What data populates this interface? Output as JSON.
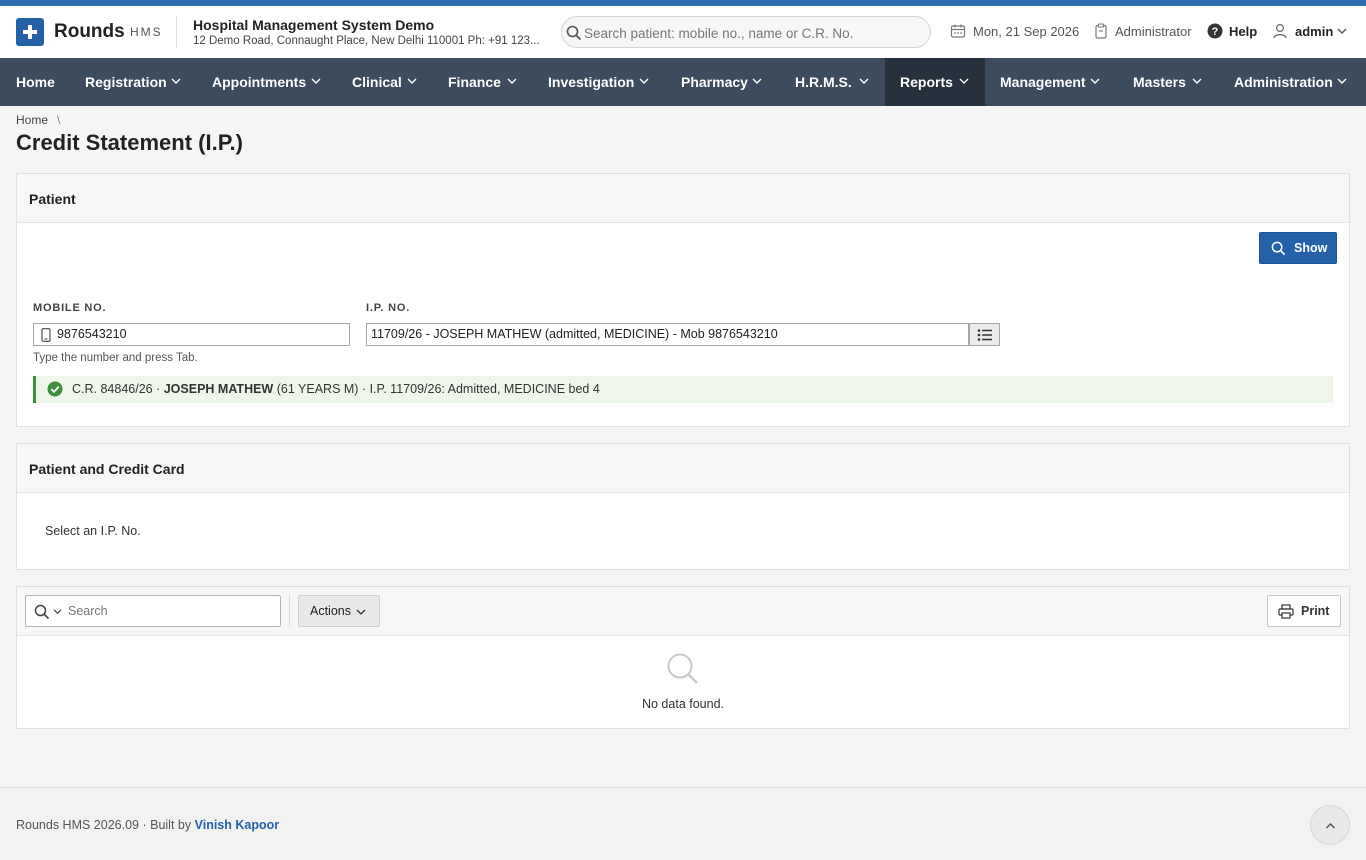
{
  "app": {
    "name": "Rounds",
    "suffix": "HMS",
    "org_name": "Hospital Management System Demo",
    "org_address": "12 Demo Road, Connaught Place, New Delhi 110001 Ph: +91 123..."
  },
  "header": {
    "search_placeholder": "Search patient: mobile no., name or C.R. No.",
    "date": "Mon, 21 Sep 2026",
    "role": "Administrator",
    "help": "Help",
    "user": "admin"
  },
  "nav": {
    "items": [
      {
        "label": "Home"
      },
      {
        "label": "Registration"
      },
      {
        "label": "Appointments"
      },
      {
        "label": "Clinical"
      },
      {
        "label": "Finance"
      },
      {
        "label": "Investigation"
      },
      {
        "label": "Pharmacy"
      },
      {
        "label": "H.R.M.S."
      },
      {
        "label": "Reports"
      },
      {
        "label": "Management"
      },
      {
        "label": "Masters"
      },
      {
        "label": "Administration"
      }
    ],
    "active": "Reports"
  },
  "breadcrumb": {
    "home": "Home",
    "separator": "\\"
  },
  "page": {
    "title": "Credit Statement (I.P.)"
  },
  "patient_panel": {
    "title": "Patient",
    "show_button": "Show",
    "mobile_label": "MOBILE NO.",
    "mobile_value": "9876543210",
    "mobile_hint": "Type the number and press Tab.",
    "ip_label": "I.P. NO.",
    "ip_value": "11709/26 - JOSEPH MATHEW (admitted, MEDICINE) - Mob 9876543210",
    "summary": {
      "prefix": "C.R. 84846/26 ·",
      "name": "JOSEPH MATHEW",
      "suffix": "(61 YEARS M) · I.P. 11709/26: Admitted, MEDICINE bed 4"
    }
  },
  "credit_panel": {
    "title": "Patient and Credit Card",
    "message": "Select an I.P. No."
  },
  "grid": {
    "search_placeholder": "Search",
    "actions_label": "Actions",
    "print_label": "Print",
    "empty_message": "No data found."
  },
  "footer": {
    "version": "Rounds HMS 2026.09",
    "built_by": "· Built by",
    "author": "Vinish Kapoor"
  },
  "colors": {
    "primary": "#2561a8",
    "nav_bg": "#3c4b5d",
    "nav_active": "#27313d",
    "success": "#3e8e3e",
    "success_bg": "#eef6ea"
  }
}
